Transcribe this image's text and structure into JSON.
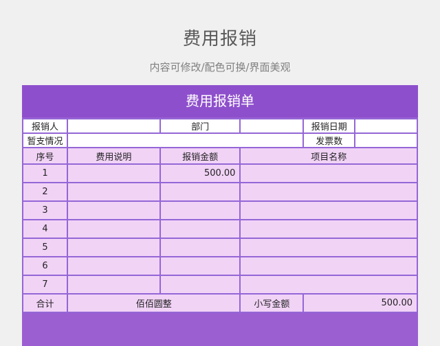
{
  "page": {
    "title": "费用报销",
    "subtitle": "内容可修改/配色可换/界面美观"
  },
  "form": {
    "title": "费用报销单",
    "info": {
      "reimburser_label": "报销人",
      "reimburser_value": "",
      "department_label": "部门",
      "department_value": "",
      "date_label": "报销日期",
      "date_value": "",
      "advance_label": "暂支情况",
      "advance_value": "",
      "invoice_count_label": "发票数",
      "invoice_count_value": ""
    },
    "columns": [
      "序号",
      "费用说明",
      "报销金额",
      "项目名称"
    ],
    "rows": [
      {
        "no": "1",
        "desc": "",
        "amount": "500.00",
        "project": ""
      },
      {
        "no": "2",
        "desc": "",
        "amount": "",
        "project": ""
      },
      {
        "no": "3",
        "desc": "",
        "amount": "",
        "project": ""
      },
      {
        "no": "4",
        "desc": "",
        "amount": "",
        "project": ""
      },
      {
        "no": "5",
        "desc": "",
        "amount": "",
        "project": ""
      },
      {
        "no": "6",
        "desc": "",
        "amount": "",
        "project": ""
      },
      {
        "no": "7",
        "desc": "",
        "amount": "",
        "project": ""
      }
    ],
    "total": {
      "label": "合计",
      "amount_in_words_label": "佰佰圆整",
      "amount_label": "小写金额",
      "amount_value": "500.00"
    }
  },
  "colors": {
    "header": "#8e4fcc",
    "border": "#9466d6",
    "cell_fill": "#f1d3f6",
    "page_bg": "#f0f0f0"
  }
}
